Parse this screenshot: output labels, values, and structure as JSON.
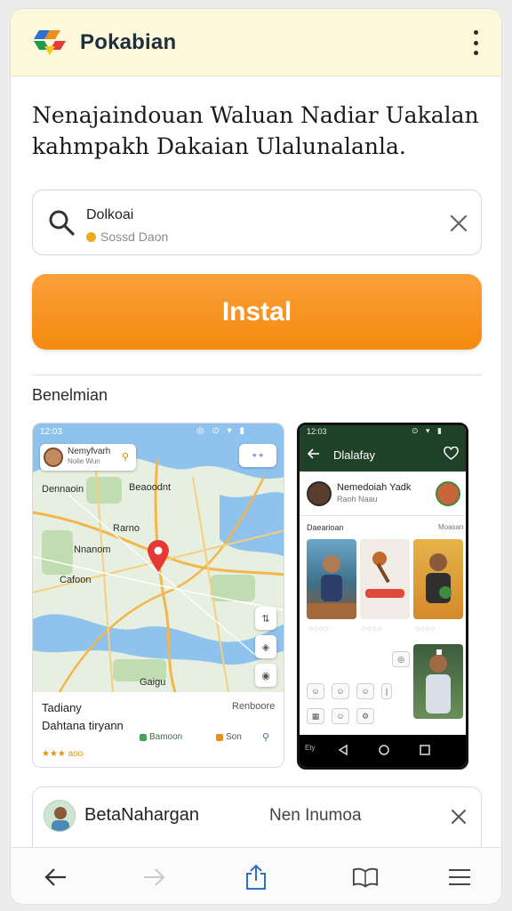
{
  "header": {
    "title": "Pokabian",
    "logo_icon": "multicolor-tile-logo",
    "menu_icon": "kebab-menu-icon"
  },
  "headline": "Nenajaindouan Waluan Nadiar Uakalan kahmpakh Dakaian Ulalunalanla.",
  "search": {
    "query": "Dolkoai",
    "subtitle": "Sossd Daon",
    "search_icon": "search-icon",
    "clear_icon": "close-icon"
  },
  "install_button": {
    "label": "Instal",
    "color": "#f7931f"
  },
  "section_label": "Benelmian",
  "screenshot_map": {
    "status_time": "12:03",
    "status_icons": "◎ ⊙ ▾ ▮",
    "user_name": "Nemyfvarh",
    "user_sub": "Nolie Wun",
    "location_button": "⌖ ⌖",
    "labels": {
      "l1": "Dennaoin",
      "l2": "Beaoodnt",
      "l3": "Rarno",
      "l4": "Nnanom",
      "l5": "Cafoon",
      "l6": "Gaigu"
    },
    "footer_title": "Tadiany",
    "footer_right": "Renboore",
    "footer_name": "Dahtana tiryann",
    "chip1": "Bamoon",
    "chip2": "Son",
    "rating": "★★★ aoo",
    "colors": {
      "water": "#8fc3ee",
      "land": "#e7efe0",
      "park": "#bfddb0",
      "road": "#f2b74b",
      "pin": "#e53935"
    }
  },
  "screenshot_phone": {
    "status_time": "12:03",
    "status_icons": "⊙ ▾ ▮",
    "title": "Dlalafay",
    "profile_name": "Nemedoiah Yadk",
    "profile_sub": "Raoh Naau",
    "section": "Daearioan",
    "section_right": "Moasan",
    "nav_label": "Ety",
    "header_color": "#1e4128"
  },
  "notification": {
    "name": "BetaNahargan",
    "message": "Nen Inumoa",
    "close_icon": "close-icon"
  },
  "bottom_bar": {
    "back_icon": "arrow-left-icon",
    "forward_icon": "arrow-right-icon",
    "share_icon": "share-icon",
    "book_icon": "book-icon",
    "menu_icon": "hamburger-menu-icon"
  }
}
